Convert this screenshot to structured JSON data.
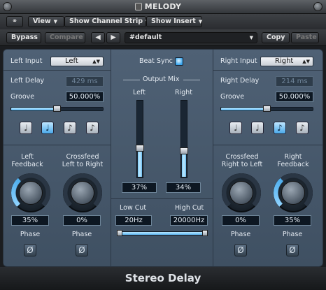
{
  "window": {
    "title": "MELODY"
  },
  "toolbar": {
    "view_label": "View",
    "channel_strip_label": "Show Channel Strip",
    "insert_label": "Show Insert",
    "bypass_label": "Bypass",
    "compare_label": "Compare",
    "prev_label": "◀",
    "next_label": "▶",
    "preset_name": "#default",
    "copy_label": "Copy",
    "paste_label": "Paste"
  },
  "left": {
    "input_label": "Left Input",
    "input_value": "Left",
    "delay_label": "Left Delay",
    "delay_value": "429 ms",
    "groove_label": "Groove",
    "groove_value": "50.000%",
    "groove_level": 0.5,
    "notes": [
      "♩",
      "♩",
      "♪",
      "♪"
    ],
    "note_selected": 1,
    "feedback_label": "Left\nFeedback",
    "feedback_value": "35%",
    "feedback_level": 0.35,
    "crossfeed_label": "Crossfeed\nLeft to Right",
    "crossfeed_value": "0%",
    "crossfeed_level": 0,
    "phase1_label": "Phase",
    "phase2_label": "Phase",
    "phase_symbol": "Ø"
  },
  "right": {
    "input_label": "Right Input",
    "input_value": "Right",
    "delay_label": "Right Delay",
    "delay_value": "214 ms",
    "groove_label": "Groove",
    "groove_value": "50.000%",
    "groove_level": 0.5,
    "notes": [
      "♩",
      "♩",
      "♪",
      "♪"
    ],
    "note_selected": 2,
    "crossfeed_label": "Crossfeed\nRight to Left",
    "crossfeed_value": "0%",
    "crossfeed_level": 0,
    "feedback_label": "Right\nFeedback",
    "feedback_value": "35%",
    "feedback_level": 0.35,
    "phase1_label": "Phase",
    "phase2_label": "Phase",
    "phase_symbol": "Ø"
  },
  "center": {
    "beat_sync_label": "Beat Sync",
    "output_mix_label": "Output Mix",
    "left_label": "Left",
    "right_label": "Right",
    "left_value": "37%",
    "left_level": 0.37,
    "right_value": "34%",
    "right_level": 0.34,
    "low_cut_label": "Low Cut",
    "high_cut_label": "High Cut",
    "low_cut_value": "20Hz",
    "high_cut_value": "20000Hz"
  },
  "footer": {
    "title": "Stereo Delay"
  },
  "colors": {
    "accent": "#5fb8f3",
    "panel": "#4a5b6e"
  }
}
